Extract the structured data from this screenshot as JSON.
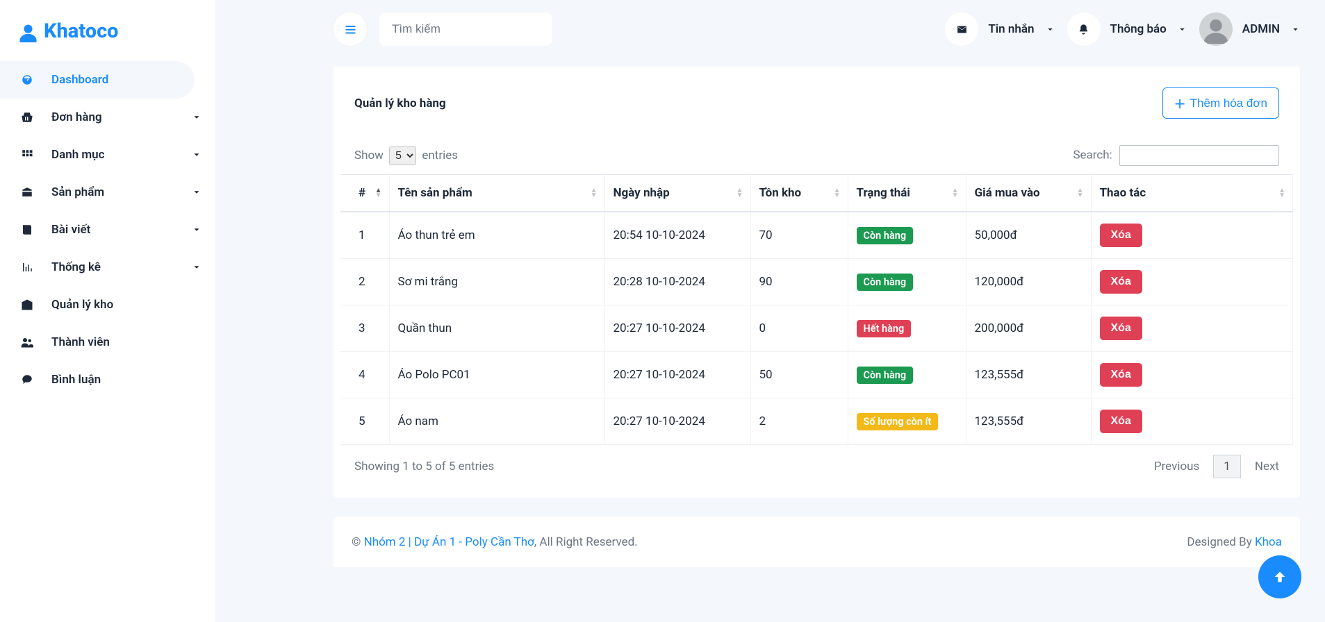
{
  "brand": {
    "name": "Khatoco"
  },
  "sidebar": {
    "items": [
      {
        "label": "Dashboard",
        "expandable": false
      },
      {
        "label": "Đơn hàng",
        "expandable": true
      },
      {
        "label": "Danh mục",
        "expandable": true
      },
      {
        "label": "Sản phẩm",
        "expandable": true
      },
      {
        "label": "Bài viết",
        "expandable": true
      },
      {
        "label": "Thống kê",
        "expandable": true
      },
      {
        "label": "Quản lý kho",
        "expandable": false
      },
      {
        "label": "Thành viên",
        "expandable": false
      },
      {
        "label": "Bình luận",
        "expandable": false
      }
    ],
    "active_index": 0
  },
  "topbar": {
    "search_placeholder": "Tìm kiếm",
    "messages_label": "Tin nhắn",
    "notifications_label": "Thông báo",
    "user_label": "ADMIN"
  },
  "card": {
    "title": "Quản lý kho hàng",
    "add_button": "Thêm hóa đơn",
    "show_label": "Show",
    "entries_label": "entries",
    "page_size": "5",
    "search_label": "Search:",
    "columns": [
      "#",
      "Tên sản phẩm",
      "Ngày nhập",
      "Tồn kho",
      "Trạng thái",
      "Giá mua vào",
      "Thao tác"
    ],
    "rows": [
      {
        "idx": "1",
        "name": "Áo thun trẻ em",
        "date": "20:54 10-10-2024",
        "stock": "70",
        "status_text": "Còn hàng",
        "status_kind": "success",
        "price": "50,000đ"
      },
      {
        "idx": "2",
        "name": "Sơ mi trắng",
        "date": "20:28 10-10-2024",
        "stock": "90",
        "status_text": "Còn hàng",
        "status_kind": "success",
        "price": "120,000đ"
      },
      {
        "idx": "3",
        "name": "Quần thun",
        "date": "20:27 10-10-2024",
        "stock": "0",
        "status_text": "Hết hàng",
        "status_kind": "danger",
        "price": "200,000đ"
      },
      {
        "idx": "4",
        "name": "Áo Polo PC01",
        "date": "20:27 10-10-2024",
        "stock": "50",
        "status_text": "Còn hàng",
        "status_kind": "success",
        "price": "123,555đ"
      },
      {
        "idx": "5",
        "name": "Áo nam",
        "date": "20:27 10-10-2024",
        "stock": "2",
        "status_text": "Số lượng còn ít",
        "status_kind": "warning",
        "price": "123,555đ"
      }
    ],
    "delete_label": "Xóa",
    "info_text": "Showing 1 to 5 of 5 entries",
    "prev_label": "Previous",
    "next_label": "Next",
    "current_page": "1"
  },
  "footer": {
    "copyright_symbol": "©",
    "project_link": "Nhóm 2 | Dự Án 1 - Poly Cần Thơ",
    "rights": ", All Right Reserved.",
    "designed_by_label": "Designed By ",
    "designer": "Khoa"
  }
}
